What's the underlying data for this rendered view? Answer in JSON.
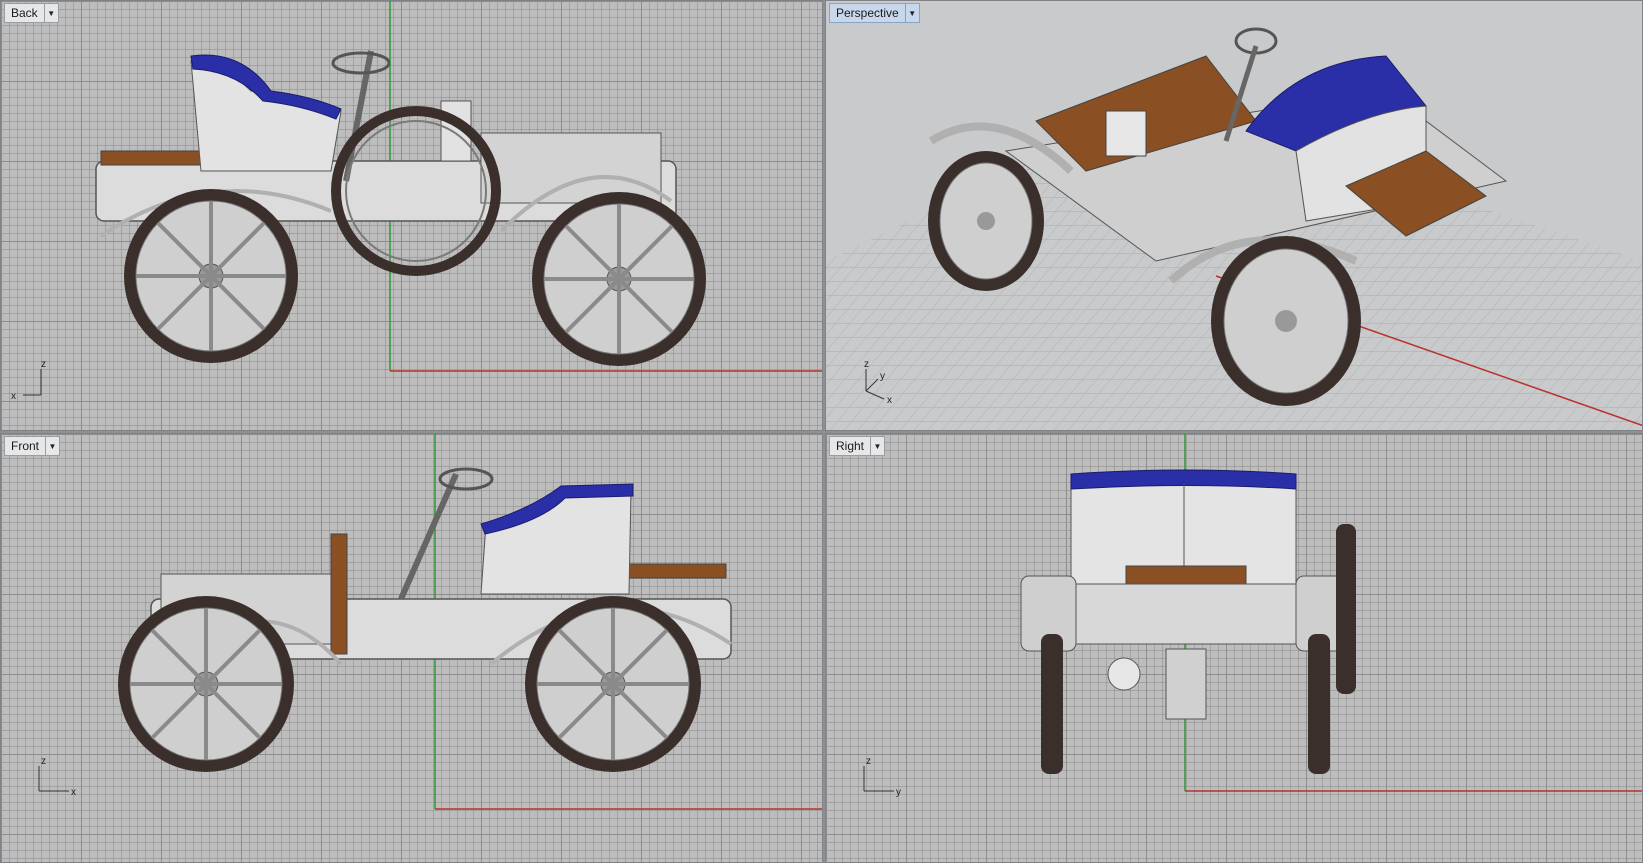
{
  "viewports": [
    {
      "id": "back",
      "label": "Back",
      "axes": {
        "h": "x",
        "v": "z"
      },
      "active": false
    },
    {
      "id": "perspective",
      "label": "Perspective",
      "axes": {
        "h": "x",
        "v": "z",
        "d": "y"
      },
      "active": true
    },
    {
      "id": "front",
      "label": "Front",
      "axes": {
        "h": "x",
        "v": "z"
      },
      "active": false
    },
    {
      "id": "right",
      "label": "Right",
      "axes": {
        "h": "y",
        "v": "z"
      },
      "active": false
    }
  ],
  "dropdown_icon": "caret-down-icon",
  "colors": {
    "seat_blue": "#2a2fa8",
    "wood": "#8a4f22",
    "tire": "#3a2f2a",
    "body": "#d8d8d8",
    "x_axis": "#b8322e",
    "y_axis": "#2e9a36"
  }
}
